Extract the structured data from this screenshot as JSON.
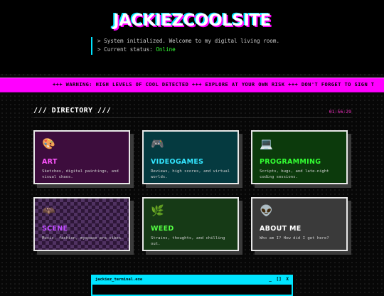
{
  "header": {
    "title": "JACKIEZCOOLSITE",
    "lines": {
      "line1": "> System initialized. Welcome to my digital living room.",
      "status_prefix": "> Current status:",
      "status_value": "Online"
    }
  },
  "marquee": {
    "text": "+++ WARNING: HIGH LEVELS OF COOL DETECTED +++ EXPLORE AT YOUR OWN RISK +++ DON'T FORGET TO SIGN T"
  },
  "directory": {
    "title": "/// DIRECTORY ///",
    "time": "01:56:29"
  },
  "cards": [
    {
      "icon": "🎨",
      "icon_name": "palette-icon",
      "name": "ART",
      "desc": "Sketches, digital paintings, and visual chaos."
    },
    {
      "icon": "🎮",
      "icon_name": "gamepad-icon",
      "name": "VIDEOGAMES",
      "desc": "Reviews, high scores, and virtual worlds."
    },
    {
      "icon": "💻",
      "icon_name": "laptop-icon",
      "name": "PROGRAMMING",
      "desc": "Scripts, bugs, and late-night coding sessions."
    },
    {
      "icon": "🦇",
      "icon_name": "bat-icon",
      "name": "SCENE",
      "desc": "Music, fashion, myspace era vibes."
    },
    {
      "icon": "🌿",
      "icon_name": "herb-icon",
      "name": "WEED",
      "desc": "Strains, thoughts, and chilling out."
    },
    {
      "icon": "👽",
      "icon_name": "alien-icon",
      "name": "ABOUT ME",
      "desc": "Who am I? How did I get here?"
    }
  ],
  "terminal": {
    "title": "jackiez_terminal.exe",
    "minimize": "_",
    "maximize": "[]",
    "close": "X"
  },
  "colors": {
    "accent_magenta": "#ff00ff",
    "accent_cyan": "#00e5ff",
    "status_green": "#33ff33"
  }
}
